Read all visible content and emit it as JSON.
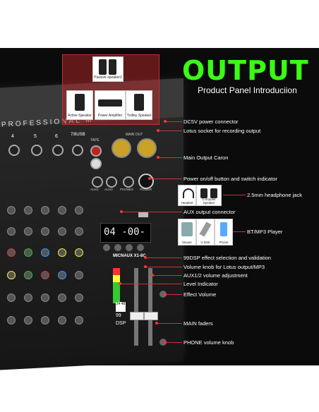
{
  "header": {
    "title": "OUTPUT",
    "subtitle": "Product Panel Introduciion"
  },
  "speakers": {
    "passive": "Passive speaker2",
    "active": "Active Speaker",
    "amplifier": "Power Amplifier",
    "trolley": "Trolley Speaker"
  },
  "devices": {
    "headset": "Headset",
    "computer_speaker": "Computer Speaker",
    "mouse": "Mouse",
    "udisk": "U Disk",
    "phone": "Phone"
  },
  "mixer": {
    "brand_strip": "PROFESSIONAL M",
    "model": "MICNAUX  X1-8C",
    "display": "04  -00-",
    "main_out": "MAIN OUT",
    "tape": "TAPE",
    "aux1": "AUX1",
    "aux2": "AUX2",
    "phones": "PHONES",
    "power": "POWER",
    "bus_label": "7/8USB",
    "ch4": "4",
    "ch5": "5",
    "ch6": "6",
    "dsp": "DSP",
    "dsp_num": "99",
    "badge": "24 48"
  },
  "annotations": [
    "DC5V power connector",
    "Lotus socket for recording output",
    "Main Output Caron",
    "Power on/off button and switch indicator",
    "2.5mm headphone jack",
    "AUX output connector",
    "BT/MP3 Player",
    "99DSP effect selection and validation",
    "Volume knob for Lotus output/MP3",
    "AUX1/2 volume adjustment",
    "Level Indicator",
    "Effect Volume",
    "MAIN faders",
    "PHONE volume knob"
  ],
  "colors": {
    "title_green": "#39ff14",
    "accent_red": "#cc3333",
    "panel_bg": "#0b0b0b"
  }
}
